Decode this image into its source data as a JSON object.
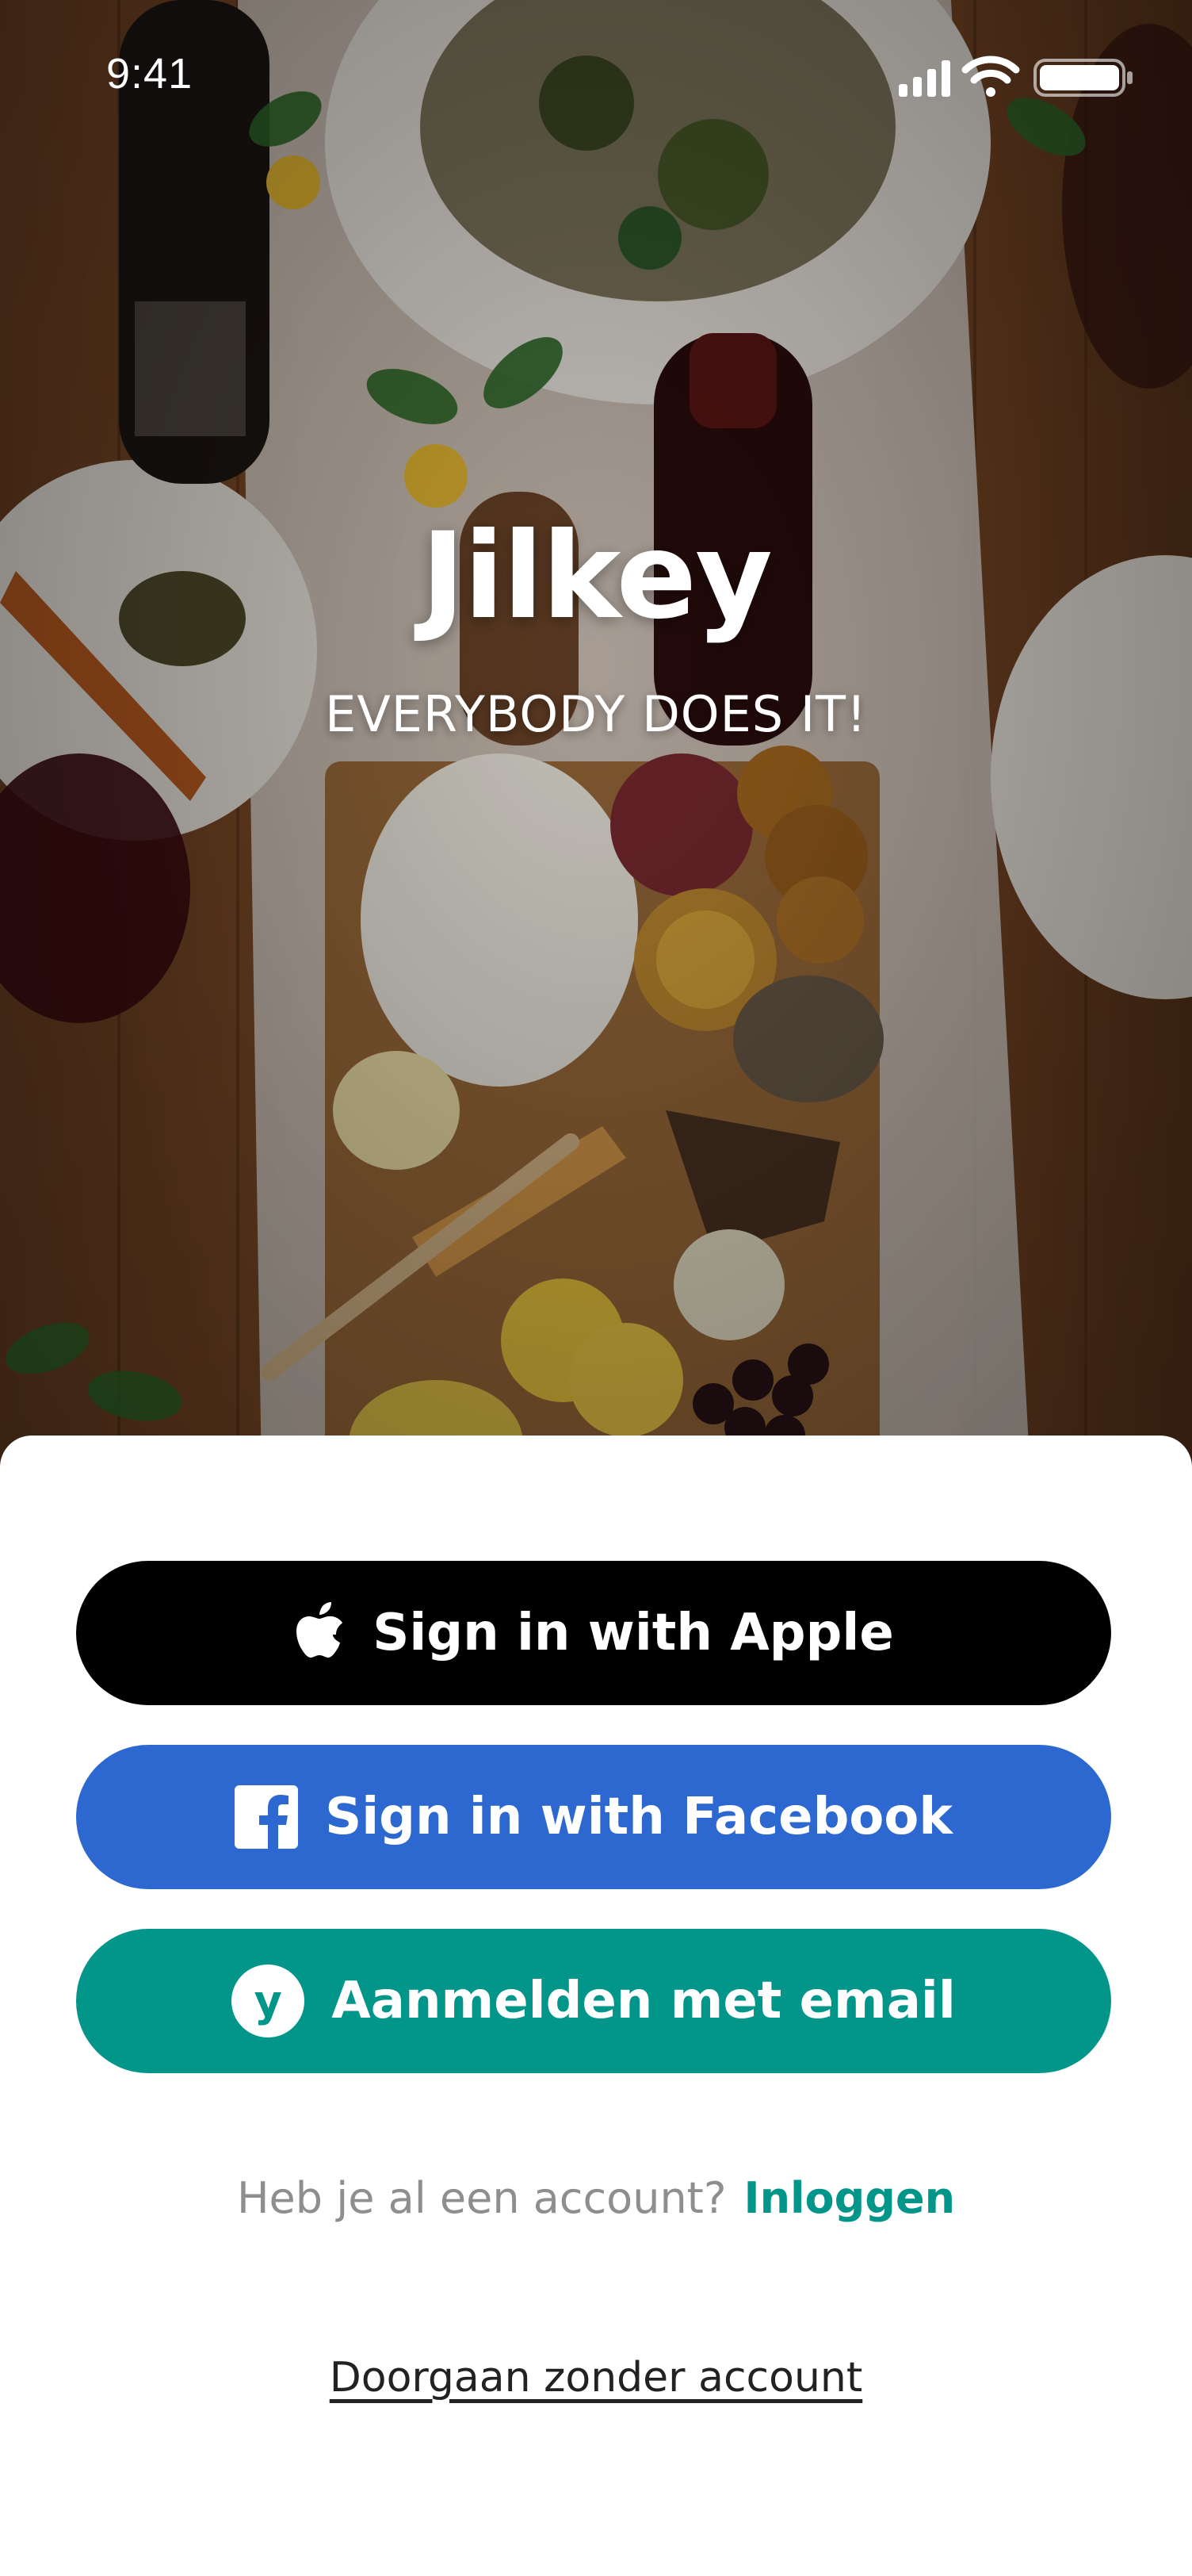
{
  "status_bar": {
    "time": "9:41",
    "icons": [
      "cellular-signal-icon",
      "wifi-icon",
      "battery-icon"
    ]
  },
  "brand": {
    "name": "Jilkey",
    "tagline": "EVERYBODY DOES IT!"
  },
  "auth": {
    "apple_label": "Sign in with Apple",
    "facebook_label": "Sign in with Facebook",
    "email_label": "Aanmelden met email",
    "email_badge_glyph": "y",
    "login_prompt": "Heb je al een account?",
    "login_link": "Inloggen",
    "skip_label": "Doorgaan zonder account"
  },
  "colors": {
    "apple_button": "#000000",
    "facebook_button": "#2d68d1",
    "email_button": "#02968b",
    "accent": "#02968b",
    "muted_text": "#8e8e8e"
  }
}
